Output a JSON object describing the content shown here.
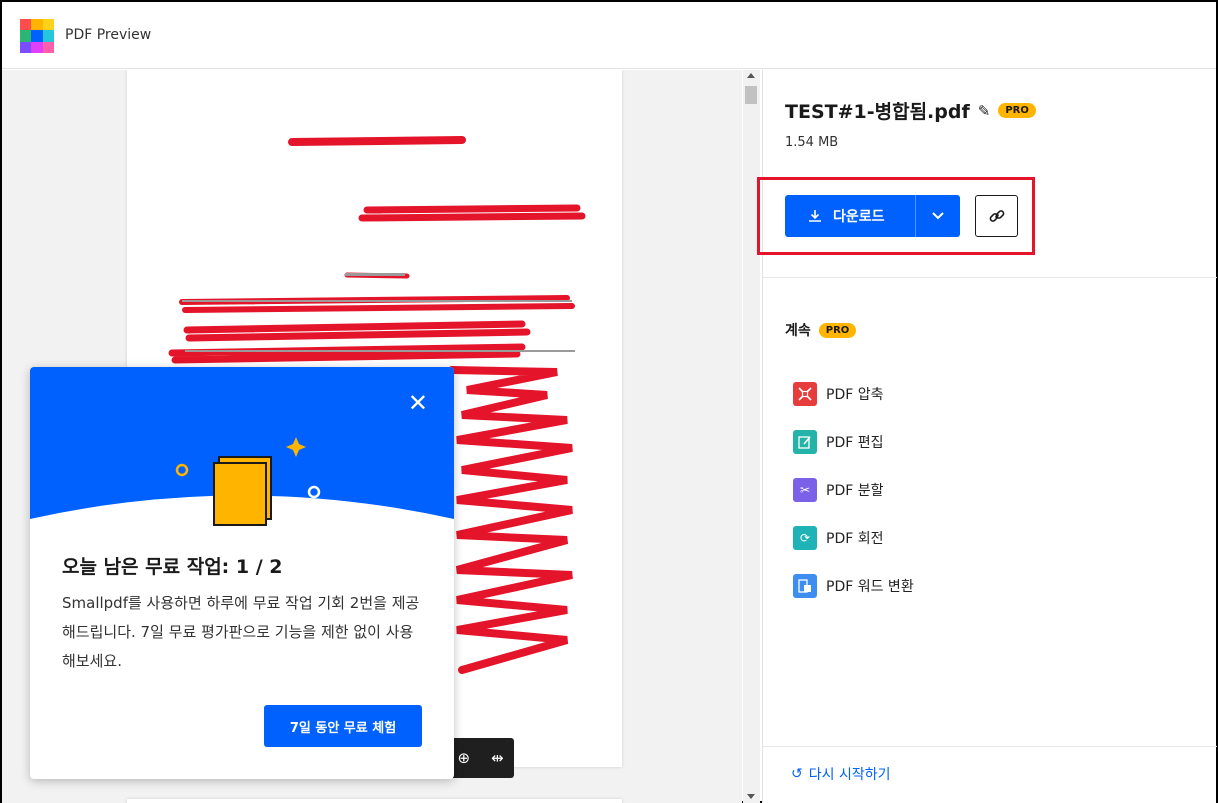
{
  "header": {
    "app_title": "PDF Preview",
    "logo_colors": [
      "#ff4d4d",
      "#ffb400",
      "#ffd11a",
      "#2bb673",
      "#0061fe",
      "#24c6dc",
      "#7c4dff",
      "#e040fb",
      "#ff5ea8"
    ]
  },
  "preview": {
    "zoom_in_icon": "zoom-in-icon",
    "fit_width_icon": "fit-width-icon"
  },
  "file": {
    "name": "TEST#1-병합됨.pdf",
    "size": "1.54 MB",
    "pro_badge": "PRO"
  },
  "actions": {
    "download_label": "다운로드",
    "highlight_color": "#e4142a",
    "primary_color": "#0061fe"
  },
  "continue": {
    "label": "계속",
    "pro_badge": "PRO",
    "tools": [
      {
        "label": "PDF 압축",
        "icon": "compress-icon",
        "color": "#e63c3c"
      },
      {
        "label": "PDF 편집",
        "icon": "edit-icon",
        "color": "#24b3a8"
      },
      {
        "label": "PDF 분할",
        "icon": "scissors-icon",
        "color": "#7b61e8"
      },
      {
        "label": "PDF 회전",
        "icon": "rotate-icon",
        "color": "#1fb3b8"
      },
      {
        "label": "PDF 워드 변환",
        "icon": "word-convert-icon",
        "color": "#3d8ef0"
      }
    ]
  },
  "restart_label": "다시 시작하기",
  "popup": {
    "title": "오늘 남은 무료 작업: 1 / 2",
    "body": "Smallpdf를 사용하면 하루에 무료 작업 기회 2번을 제공해드립니다. 7일 무료 평가판으로 기능을 제한 없이 사용해보세요.",
    "cta": "7일 동안 무료 체험",
    "hero_color": "#0061fe",
    "accent_color": "#ffb400"
  }
}
